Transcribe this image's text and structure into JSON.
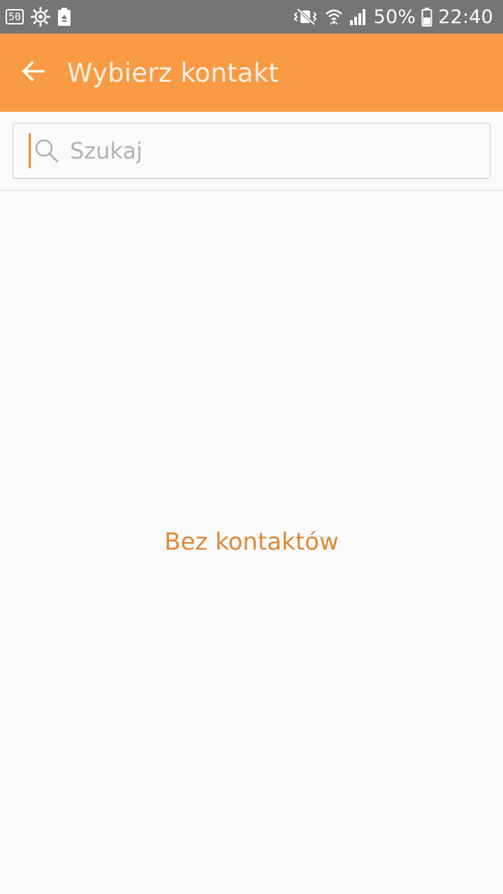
{
  "status_bar": {
    "left_badge": "50",
    "left_icons": [
      "badge-50-icon",
      "sun-settings-icon",
      "battery-saver-recycle-icon"
    ],
    "right_icons": [
      "mute-vibrate-icon",
      "wifi-icon",
      "signal-icon",
      "battery-icon"
    ],
    "battery_percent": "50%",
    "time": "22:40",
    "background": "#757575"
  },
  "app_bar": {
    "title": "Wybierz kontakt",
    "background": "#f99a45",
    "back_icon": "arrow-left-icon"
  },
  "search": {
    "placeholder": "Szukaj",
    "value": "",
    "icon": "search-icon"
  },
  "empty_state": {
    "message": "Bez kontaktów",
    "color": "#de8a3a"
  }
}
